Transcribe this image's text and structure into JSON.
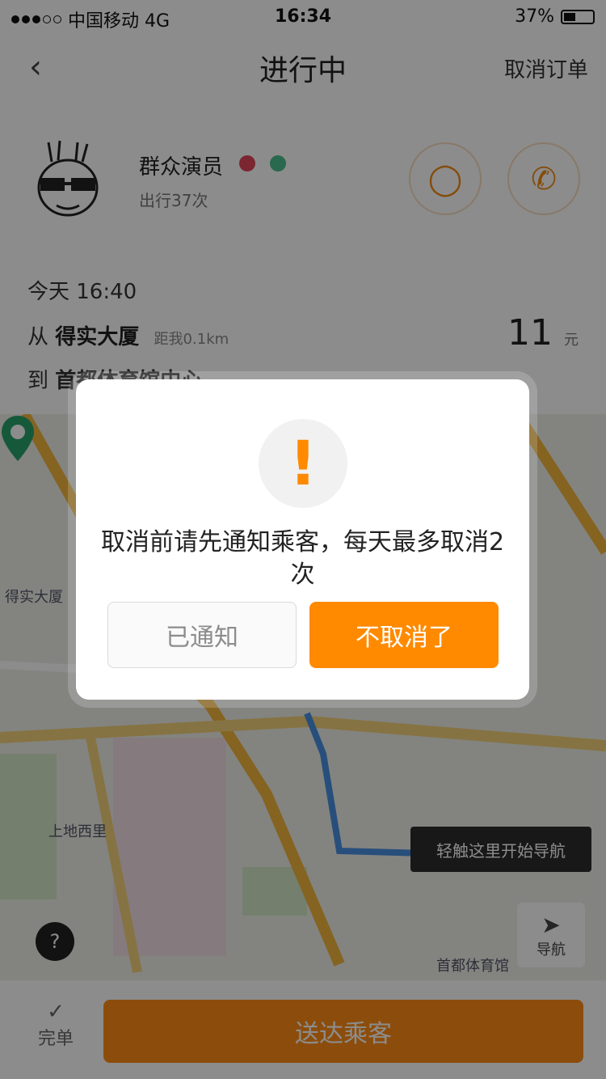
{
  "status_bar": {
    "carrier": "中国移动 4G",
    "time": "16:34",
    "battery": "37%"
  },
  "nav": {
    "back_icon": "chevron-left-icon",
    "title": "进行中",
    "right_action": "取消订单"
  },
  "profile": {
    "name": "群众演员",
    "sub": "出行37次"
  },
  "trip": {
    "time": "今天 16:40",
    "from_prefix": "从",
    "from_place": "得实大厦",
    "from_distance": "距我0.1km",
    "to_prefix": "到",
    "to_place": "首都体育馆中心",
    "fee": "11",
    "fee_unit": "元"
  },
  "map": {
    "tip": "轻触这里开始导航",
    "nav_label": "导航",
    "label_a": "得实大厦",
    "label_b": "上地西里",
    "label_c": "首都体育馆"
  },
  "bottom": {
    "done_label": "完单",
    "main_button": "送达乘客"
  },
  "dialog": {
    "icon": "exclamation-icon",
    "message": "取消前请先通知乘客，每天最多取消2次",
    "btn_notified": "已通知",
    "btn_keep": "不取消了"
  },
  "colors": {
    "accent": "#FF8A00",
    "overlay": "rgba(0,0,0,0.45)"
  }
}
